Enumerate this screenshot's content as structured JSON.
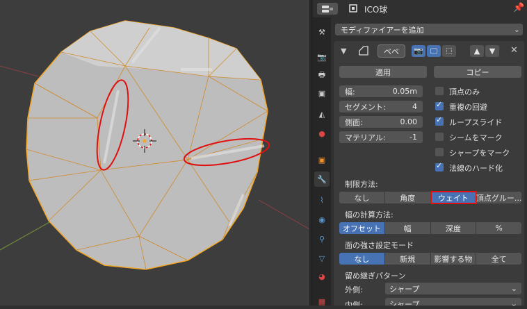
{
  "header": {
    "object_name": "ICO球"
  },
  "modifier_panel": {
    "add_modifier": "モディファイアーを追加",
    "modifier_name": "ベベ",
    "apply_button": "適用",
    "copy_button": "コピー",
    "fields": [
      {
        "label": "幅:",
        "value": "0.05m"
      },
      {
        "label": "セグメント:",
        "value": "4"
      },
      {
        "label": "側面:",
        "value": "0.00"
      },
      {
        "label": "マテリアル:",
        "value": "-1"
      }
    ],
    "checkboxes": [
      {
        "label": "頂点のみ",
        "checked": false
      },
      {
        "label": "重複の回避",
        "checked": true
      },
      {
        "label": "ループスライド",
        "checked": true
      },
      {
        "label": "シームをマーク",
        "checked": false
      },
      {
        "label": "シャープをマーク",
        "checked": false
      },
      {
        "label": "法線のハード化",
        "checked": true
      }
    ],
    "limit_method": {
      "label": "制限方法:",
      "options": [
        "なし",
        "角度",
        "ウェイト",
        "頂点グルー..."
      ],
      "selected": "ウェイト"
    },
    "width_method": {
      "label": "幅の計算方法:",
      "options": [
        "オフセット",
        "幅",
        "深度",
        "%"
      ],
      "selected": "オフセット"
    },
    "face_strength": {
      "label": "面の強さ設定モード",
      "options": [
        "なし",
        "新規",
        "影響する物",
        "全て"
      ],
      "selected": "なし"
    },
    "miter": {
      "label": "留め継ぎパターン",
      "outer_label": "外側:",
      "outer_value": "シャープ",
      "inner_label": "内側:",
      "inner_value": "シャープ"
    }
  },
  "colors": {
    "accent": "#4772b3",
    "highlight_red": "#e01010",
    "selection_orange": "#f5a623"
  }
}
